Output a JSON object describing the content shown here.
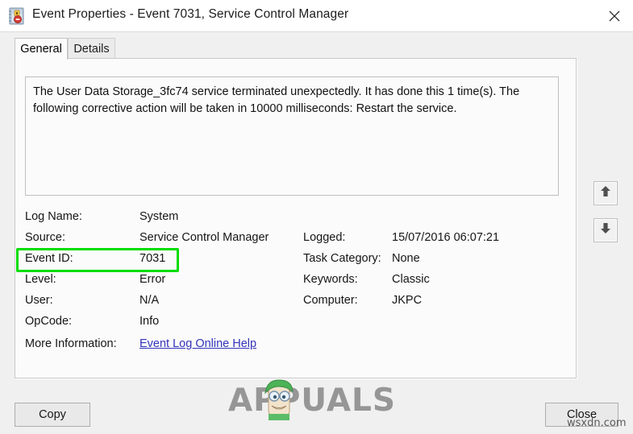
{
  "window": {
    "title": "Event Properties - Event 7031, Service Control Manager",
    "icon": "event-log-error-icon",
    "close_icon": "close-icon"
  },
  "tabs": [
    {
      "label": "General",
      "active": true
    },
    {
      "label": "Details",
      "active": false
    }
  ],
  "description": "The User Data Storage_3fc74 service terminated unexpectedly. It has done this 1 time(s). The following corrective action will be taken in 10000 milliseconds: Restart the service.",
  "fields_left": [
    {
      "label": "Log Name:",
      "value": "System"
    },
    {
      "label": "Source:",
      "value": "Service Control Manager"
    },
    {
      "label": "Event ID:",
      "value": "7031"
    },
    {
      "label": "Level:",
      "value": "Error"
    },
    {
      "label": "User:",
      "value": "N/A"
    },
    {
      "label": "OpCode:",
      "value": "Info"
    }
  ],
  "fields_right": [
    {
      "label": "Logged:",
      "value": "15/07/2016 06:07:21"
    },
    {
      "label": "Task Category:",
      "value": "None"
    },
    {
      "label": "Keywords:",
      "value": "Classic"
    },
    {
      "label": "Computer:",
      "value": "JKPC"
    }
  ],
  "more_information": {
    "label": "More Information:",
    "link_text": "Event Log Online Help"
  },
  "nav": {
    "up_icon": "arrow-up-icon",
    "down_icon": "arrow-down-icon"
  },
  "buttons": {
    "copy": "Copy",
    "close": "Close"
  },
  "annotation": {
    "highlight_color": "#00dd00",
    "highlights_field": "Event ID:"
  },
  "watermarks": {
    "brand": "APPUALS",
    "site": "wsxdn.com"
  }
}
